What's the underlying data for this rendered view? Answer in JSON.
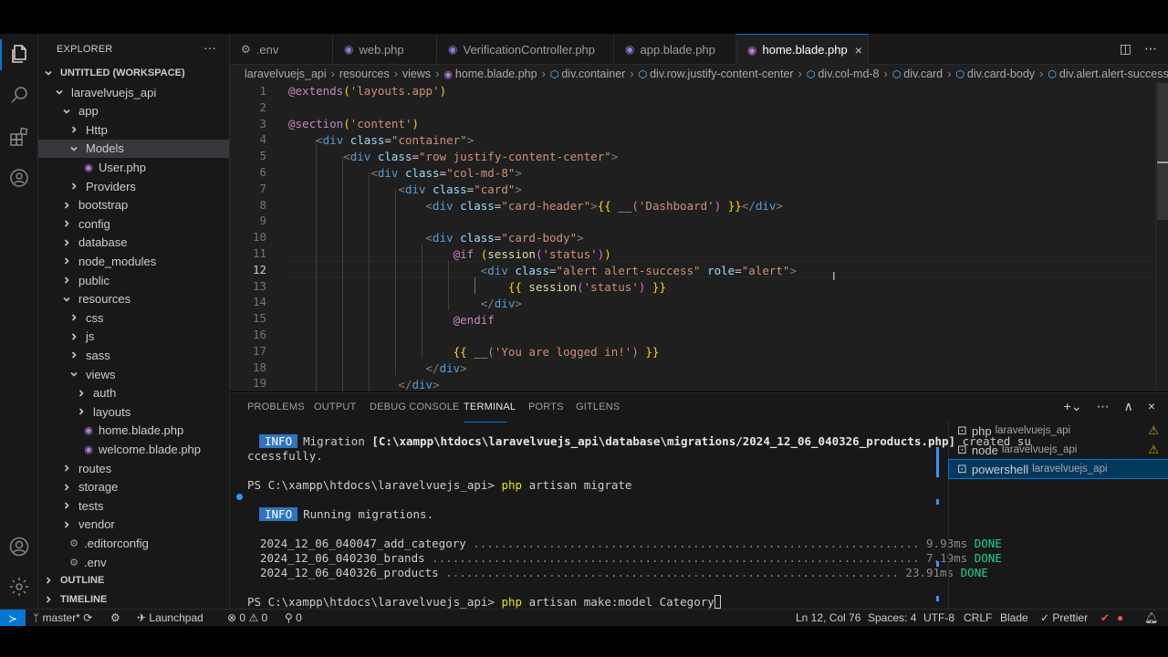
{
  "colors": {
    "accent": "#0078d4",
    "editor_bg": "#1f1f1f",
    "sidebar_bg": "#181818",
    "info_badge": "#2f74c0",
    "done_green": "#23d18b",
    "warning": "#cca700"
  },
  "activity_icons": [
    "files-icon",
    "search-icon",
    "extensions-icon",
    "remote-explorer-icon",
    "account-icon",
    "settings-gear-icon"
  ],
  "sidebar": {
    "title": "EXPLORER",
    "more": "···",
    "workspace": "UNTITLED (WORKSPACE)",
    "tree": [
      {
        "label": "laravelvuejs_api",
        "chev": "open"
      },
      {
        "label": "app",
        "chev": "open"
      },
      {
        "label": "Http",
        "chev": "closed"
      },
      {
        "label": "Models",
        "chev": "open"
      },
      {
        "label": "User.php",
        "chev": "file"
      },
      {
        "label": "Providers",
        "chev": "closed"
      },
      {
        "label": "bootstrap",
        "chev": "closed"
      },
      {
        "label": "config",
        "chev": "closed"
      },
      {
        "label": "database",
        "chev": "closed"
      },
      {
        "label": "node_modules",
        "chev": "closed"
      },
      {
        "label": "public",
        "chev": "closed"
      },
      {
        "label": "resources",
        "chev": "open"
      },
      {
        "label": "css",
        "chev": "closed"
      },
      {
        "label": "js",
        "chev": "closed"
      },
      {
        "label": "sass",
        "chev": "closed"
      },
      {
        "label": "views",
        "chev": "open"
      },
      {
        "label": "auth",
        "chev": "closed"
      },
      {
        "label": "layouts",
        "chev": "closed"
      },
      {
        "label": "home.blade.php",
        "chev": "file"
      },
      {
        "label": "welcome.blade.php",
        "chev": "file"
      },
      {
        "label": "routes",
        "chev": "closed"
      },
      {
        "label": "storage",
        "chev": "closed"
      },
      {
        "label": "tests",
        "chev": "closed"
      },
      {
        "label": "vendor",
        "chev": "closed"
      },
      {
        "label": ".editorconfig",
        "chev": "file"
      },
      {
        "label": ".env",
        "chev": "file"
      }
    ],
    "outline": "OUTLINE",
    "timeline": "TIMELINE"
  },
  "tabs": [
    {
      "label": ".env",
      "icon": "⚙"
    },
    {
      "label": "web.php",
      "icon": "🐘"
    },
    {
      "label": "VerificationController.php",
      "icon": "🐘"
    },
    {
      "label": "app.blade.php",
      "icon": "🐘"
    },
    {
      "label": "home.blade.php",
      "icon": "🐘",
      "active": true
    }
  ],
  "tab_close": "×",
  "breadcrumb": [
    "laravelvuejs_api",
    "resources",
    "views",
    "home.blade.php",
    "div.container",
    "div.row.justify-content-center",
    "div.col-md-8",
    "div.card",
    "div.card-body",
    "div.alert.alert-success"
  ],
  "editor": {
    "current_line": 12,
    "line_numbers": [
      "1",
      "2",
      "3",
      "4",
      "5",
      "6",
      "7",
      "8",
      "9",
      "10",
      "11",
      "12",
      "13",
      "14",
      "15",
      "16",
      "17",
      "18",
      "19"
    ]
  },
  "panel": {
    "tabs": [
      "PROBLEMS",
      "OUTPUT",
      "DEBUG CONSOLE",
      "TERMINAL",
      "PORTS",
      "GITLENS"
    ],
    "active_tab": "TERMINAL",
    "terminal": {
      "info_label": "INFO",
      "migration_prefix": "Migration",
      "migration_path": "[C:\\xampp\\htdocs\\laravelvuejs_api\\database\\migrations/2024_12_06_040326_products.php]",
      "migration_suffix": "created su",
      "migration_wrap": "ccessfully.",
      "prompt1": "PS C:\\xampp\\htdocs\\laravelvuejs_api>",
      "cmd1_exe": "php",
      "cmd1_args": "artisan migrate",
      "running": "Running migrations.",
      "migrations": [
        {
          "name": "2024_12_06_040047_add_category",
          "dots": " .................................................................",
          "time": "9.93ms",
          "status": "DONE"
        },
        {
          "name": "2024_12_06_040230_brands",
          "dots": " .......................................................................",
          "time": "7.19ms",
          "status": "DONE"
        },
        {
          "name": "2024_12_06_040326_products",
          "dots": " ..................................................................",
          "time": "23.91ms",
          "status": "DONE"
        }
      ],
      "prompt2": "PS C:\\xampp\\htdocs\\laravelvuejs_api>",
      "cmd2_exe": "php",
      "cmd2_args": "artisan make:model Category"
    },
    "terminals": [
      {
        "name": "php",
        "cwd": "laravelvuejs_api",
        "warning": true
      },
      {
        "name": "node",
        "cwd": "laravelvuejs_api",
        "warning": true
      },
      {
        "name": "powershell",
        "cwd": "laravelvuejs_api",
        "active": true
      }
    ]
  },
  "statusbar": {
    "branch": "master*",
    "launchpad": "Launchpad",
    "errors": "0",
    "warnings": "0",
    "ports": "0",
    "position": "Ln 12, Col 76",
    "spaces": "Spaces: 4",
    "encoding": "UTF-8",
    "eol": "CRLF",
    "language": "Blade",
    "prettier": "Prettier"
  }
}
